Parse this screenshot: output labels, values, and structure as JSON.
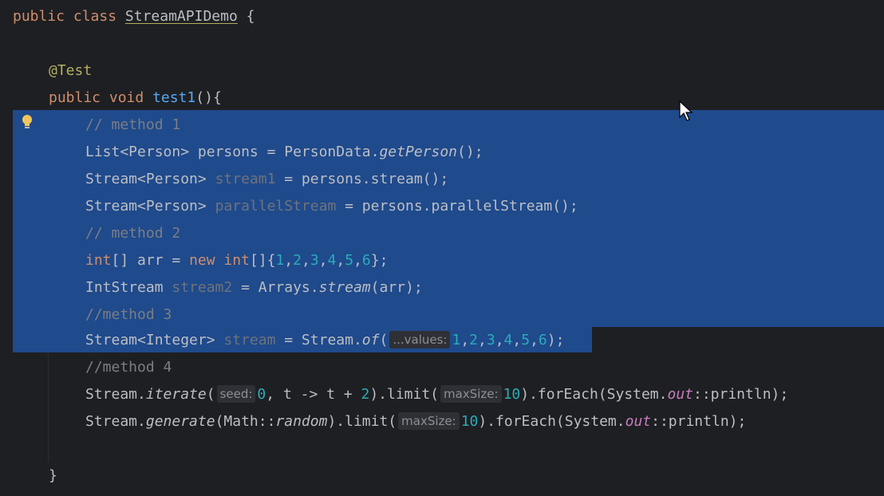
{
  "class_decl": {
    "kw1": "public",
    "kw2": "class",
    "name": "StreamAPIDemo",
    "brace": "{"
  },
  "annotation": "@Test",
  "method_decl": {
    "kw1": "public",
    "kw2": "void",
    "name": "test1",
    "rest": "(){"
  },
  "comments": {
    "c1": "// method 1",
    "c2": "// method 2",
    "c3": "//method 3",
    "c4": "//method 4"
  },
  "l5": {
    "a": "List<Person> persons = PersonData.",
    "b": "getPerson",
    "c": "();"
  },
  "l6": {
    "a": "Stream<Person> ",
    "b": "stream1",
    "c": " = persons.stream();"
  },
  "l7": {
    "a": "Stream<Person> ",
    "b": "parallelStream",
    "c": " = persons.parallelStream();"
  },
  "l9": {
    "t1": "int",
    "t2": "[] arr = ",
    "t3": "new",
    "t4": " ",
    "t5": "int",
    "t6": "[]{",
    "nums": [
      "1",
      "2",
      "3",
      "4",
      "5",
      "6"
    ],
    "sep": ",",
    "end": "};"
  },
  "l10": {
    "a": "IntStream ",
    "b": "stream2",
    "c": " = Arrays.",
    "d": "stream",
    "e": "(arr);"
  },
  "l12": {
    "a": "Stream<Integer> ",
    "b": "stream",
    "c": " = Stream.",
    "d": "of",
    "e": "(",
    "hint": "...values:",
    "nums": [
      "1",
      "2",
      "3",
      "4",
      "5",
      "6"
    ],
    "sep": ",",
    "end": ");"
  },
  "l14": {
    "a": "Stream.",
    "b": "iterate",
    "c": "(",
    "hint1": "seed:",
    "n1": "0",
    "d": ", t -> t + ",
    "n2": "2",
    "e": ").limit(",
    "hint2": "maxSize:",
    "n3": "10",
    "f": ").forEach(System.",
    "g": "out",
    "h": "::println);"
  },
  "l15": {
    "a": "Stream.",
    "b": "generate",
    "c": "(Math::",
    "d": "random",
    "e": ").limit(",
    "hint": "maxSize:",
    "n": "10",
    "f": ").forEach(System.",
    "g": "out",
    "h": "::println);"
  },
  "closing_brace": "}",
  "colors": {
    "background": "#1e1f22",
    "selection": "#1f4a8c",
    "keyword": "#cf8e6d",
    "annotation": "#b3ae60",
    "method_name": "#56a8f5",
    "number": "#2aacb8",
    "static_field": "#c77dbb",
    "comment": "#7a7e85"
  },
  "icons": [
    "lightbulb-icon",
    "mouse-cursor-icon"
  ]
}
